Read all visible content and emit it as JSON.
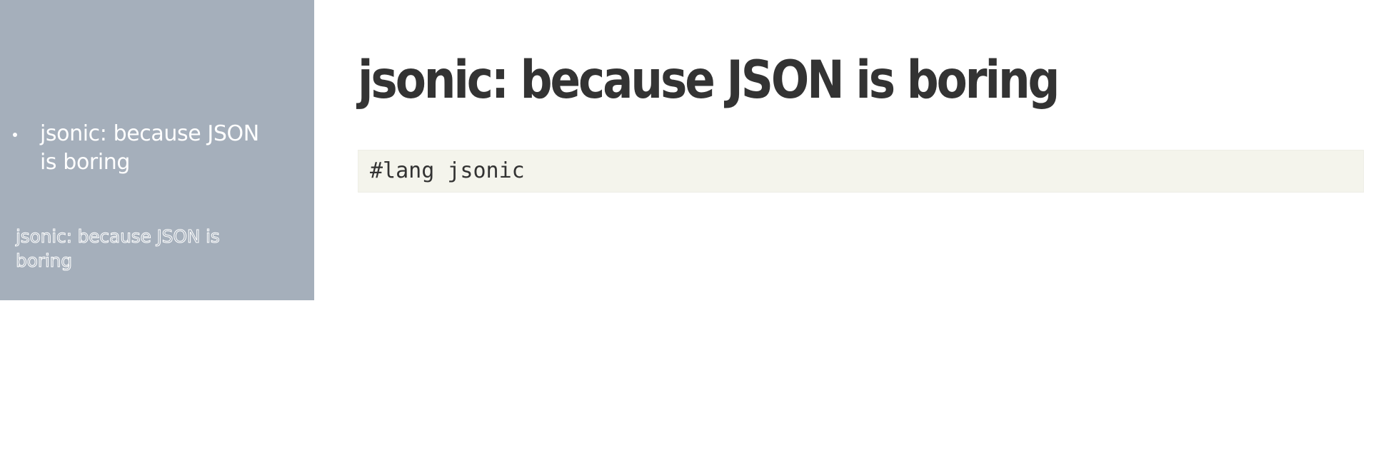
{
  "sidebar": {
    "toc": [
      {
        "label": "jsonic: because JSON is boring"
      }
    ],
    "subtitle": "jsonic: because JSON is boring"
  },
  "main": {
    "title": "jsonic: because JSON is boring",
    "code": "#lang jsonic"
  },
  "colors": {
    "sidebar_background": "#a5afbb",
    "code_background": "#f4f4ec",
    "text": "#333333"
  }
}
